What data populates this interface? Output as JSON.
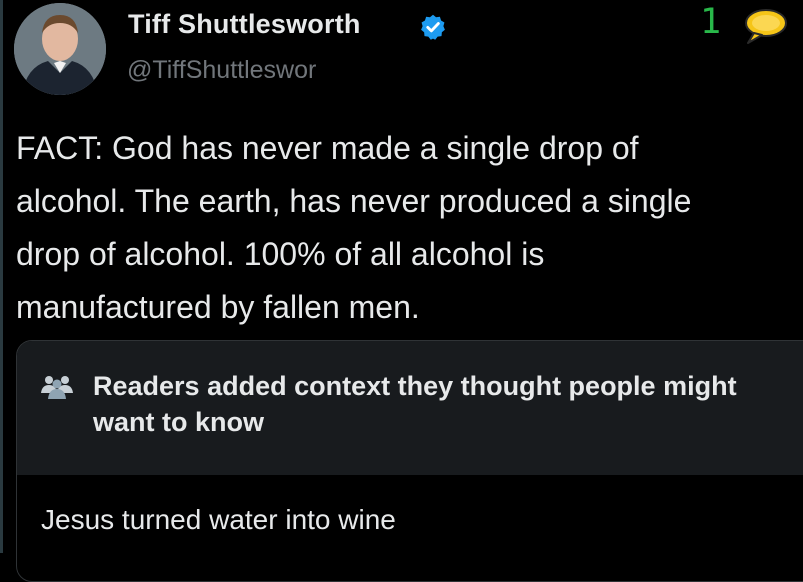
{
  "user": {
    "display_name": "Tiff Shuttlesworth",
    "handle": "@TiffShuttleswor",
    "verified": true
  },
  "overlay": {
    "count": "1",
    "icon": "speech-bubble-icon"
  },
  "tweet": {
    "lines": [
      "FACT: God has never made a single drop of",
      "alcohol. The earth, has never produced a single",
      "drop of alcohol. 100% of all alcohol is",
      "manufactured by fallen men."
    ]
  },
  "community_note": {
    "title": "Readers added context they thought people might want to know",
    "body": "Jesus turned water into wine",
    "icon": "people-icon"
  },
  "colors": {
    "background": "#000000",
    "text": "#e7e9ea",
    "muted": "#71767b",
    "verified": "#1d9bf0",
    "note_header": "#181b1e",
    "counter": "#29b84a",
    "bubble": "#f5c518"
  }
}
